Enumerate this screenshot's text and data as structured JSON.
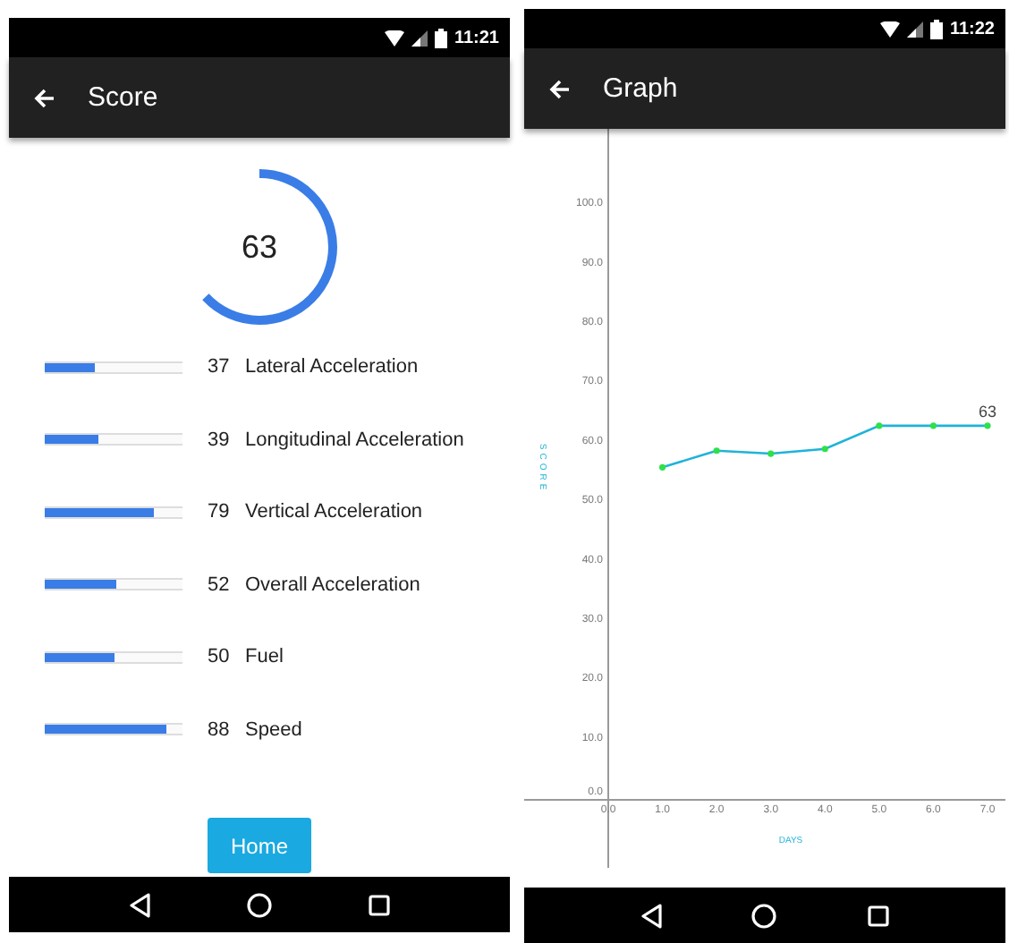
{
  "screens": [
    {
      "kind": "score",
      "status_bar": {
        "time": "11:21"
      },
      "app_bar": {
        "title": "Score"
      },
      "gauge": {
        "value": "63",
        "level": 0.63
      },
      "metrics": [
        {
          "value": "37",
          "label": "Lateral Acceleration",
          "level": 0.37
        },
        {
          "value": "39",
          "label": "Longitudinal Acceleration",
          "level": 0.39
        },
        {
          "value": "79",
          "label": "Vertical Acceleration",
          "level": 0.79
        },
        {
          "value": "52",
          "label": "Overall Acceleration",
          "level": 0.52
        },
        {
          "value": "50",
          "label": "Fuel",
          "level": 0.5
        },
        {
          "value": "88",
          "label": "Speed",
          "level": 0.88
        }
      ],
      "button": "Home"
    },
    {
      "kind": "graph",
      "status_bar": {
        "time": "11:22"
      },
      "app_bar": {
        "title": "Graph"
      },
      "chart_data": {
        "type": "line",
        "xlabel": "DAYS",
        "ylabel": "SCORE",
        "x": [
          1,
          2,
          3,
          4,
          5,
          6,
          7
        ],
        "series": [
          {
            "color": "#1fb3d8",
            "marker": "circle",
            "values": [
              56,
              58.8,
              58.3,
              59.1,
              63,
              63,
              63
            ]
          }
        ],
        "xlim": [
          0,
          7.33
        ],
        "ylim": [
          0,
          113
        ],
        "xticks": [
          {
            "value": 0,
            "label": "0.0"
          },
          {
            "value": 1,
            "label": "1.0"
          },
          {
            "value": 2,
            "label": "2.0"
          },
          {
            "value": 3,
            "label": "3.0"
          },
          {
            "value": 4,
            "label": "4.0"
          },
          {
            "value": 5,
            "label": "5.0"
          },
          {
            "value": 6,
            "label": "6.0"
          },
          {
            "value": 7,
            "label": "7.0"
          }
        ],
        "yticks": [
          {
            "value": 0,
            "label": "0.0"
          },
          {
            "value": 10,
            "label": "10.0"
          },
          {
            "value": 20,
            "label": "20.0"
          },
          {
            "value": 30,
            "label": "30.0"
          },
          {
            "value": 40,
            "label": "40.0"
          },
          {
            "value": 50,
            "label": "50.0"
          },
          {
            "value": 60,
            "label": "60.0"
          },
          {
            "value": 70,
            "label": "70.0"
          },
          {
            "value": 80,
            "label": "80.0"
          },
          {
            "value": 90,
            "label": "90.0"
          },
          {
            "value": 100,
            "label": "100.0"
          }
        ],
        "annotations": [
          {
            "x": 7,
            "y": 63,
            "text": "63"
          }
        ]
      }
    }
  ]
}
